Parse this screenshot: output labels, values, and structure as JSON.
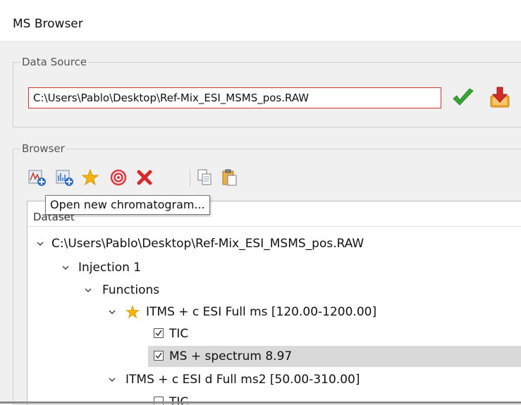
{
  "window": {
    "title": "MS Browser"
  },
  "data_source": {
    "legend": "Data Source",
    "path": "C:\\Users\\Pablo\\Desktop\\Ref-Mix_ESI_MSMS_pos.RAW",
    "confirm_icon": "green-check-icon",
    "load_icon": "download-arrow-icon"
  },
  "browser": {
    "legend": "Browser",
    "toolbar": [
      {
        "name": "open-new-chromatogram-icon"
      },
      {
        "name": "open-new-spectrum-icon"
      },
      {
        "name": "star-icon"
      },
      {
        "name": "target-icon"
      },
      {
        "name": "delete-x-icon"
      },
      {
        "name": "copy-icon"
      },
      {
        "name": "paste-icon"
      }
    ],
    "tooltip": "Open new chromatogram...",
    "tree_header": "Dataset",
    "tree": {
      "root": "C:\\Users\\Pablo\\Desktop\\Ref-Mix_ESI_MSMS_pos.RAW",
      "injection": "Injection 1",
      "functions": "Functions",
      "func1": "ITMS + c ESI Full ms [120.00-1200.00]",
      "func1_tic": "TIC",
      "func1_spectrum": "MS + spectrum 8.97",
      "func2": "ITMS + c ESI d Full ms2 [50.00-310.00]",
      "func2_tic": "TIC"
    }
  },
  "colors": {
    "error_border": "#c8362f",
    "check_green": "#3aa535",
    "star": "#f5b400",
    "target": "#e2383f",
    "delete": "#d92a2a",
    "selected_row": "#d9d9d9"
  }
}
